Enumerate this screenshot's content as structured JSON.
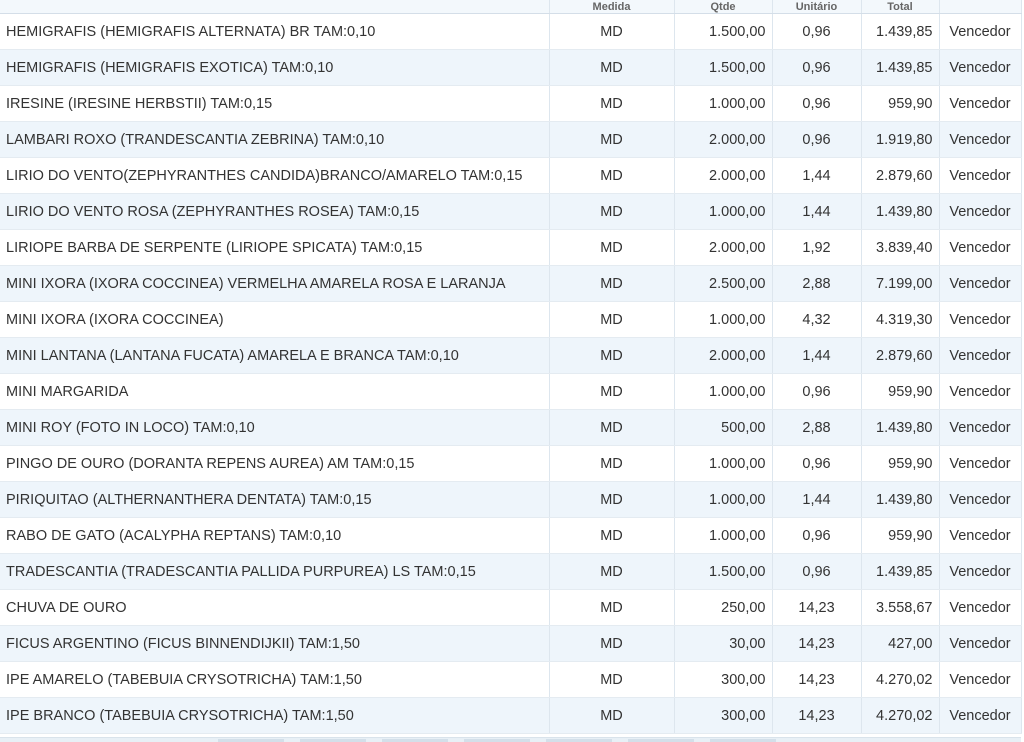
{
  "table": {
    "headers": [
      "Medida",
      "Qtde",
      "Unitário",
      "Total",
      ""
    ],
    "rows": [
      {
        "description": "HEMIGRAFIS (HEMIGRAFIS ALTERNATA) BR TAM:0,10",
        "unit": "MD",
        "quantity": "1.500,00",
        "unit_price": "0,96",
        "total": "1.439,85",
        "status": "Vencedor"
      },
      {
        "description": "HEMIGRAFIS (HEMIGRAFIS EXOTICA) TAM:0,10",
        "unit": "MD",
        "quantity": "1.500,00",
        "unit_price": "0,96",
        "total": "1.439,85",
        "status": "Vencedor"
      },
      {
        "description": "IRESINE (IRESINE HERBSTII) TAM:0,15",
        "unit": "MD",
        "quantity": "1.000,00",
        "unit_price": "0,96",
        "total": "959,90",
        "status": "Vencedor"
      },
      {
        "description": "LAMBARI ROXO (TRANDESCANTIA ZEBRINA) TAM:0,10",
        "unit": "MD",
        "quantity": "2.000,00",
        "unit_price": "0,96",
        "total": "1.919,80",
        "status": "Vencedor"
      },
      {
        "description": "LIRIO DO VENTO(ZEPHYRANTHES CANDIDA)BRANCO/AMARELO TAM:0,15",
        "unit": "MD",
        "quantity": "2.000,00",
        "unit_price": "1,44",
        "total": "2.879,60",
        "status": "Vencedor"
      },
      {
        "description": "LIRIO DO VENTO ROSA (ZEPHYRANTHES ROSEA) TAM:0,15",
        "unit": "MD",
        "quantity": "1.000,00",
        "unit_price": "1,44",
        "total": "1.439,80",
        "status": "Vencedor"
      },
      {
        "description": "LIRIOPE BARBA DE SERPENTE (LIRIOPE SPICATA) TAM:0,15",
        "unit": "MD",
        "quantity": "2.000,00",
        "unit_price": "1,92",
        "total": "3.839,40",
        "status": "Vencedor"
      },
      {
        "description": "MINI IXORA (IXORA COCCINEA) VERMELHA AMARELA ROSA E LARANJA",
        "unit": "MD",
        "quantity": "2.500,00",
        "unit_price": "2,88",
        "total": "7.199,00",
        "status": "Vencedor"
      },
      {
        "description": "MINI IXORA (IXORA COCCINEA)",
        "unit": "MD",
        "quantity": "1.000,00",
        "unit_price": "4,32",
        "total": "4.319,30",
        "status": "Vencedor"
      },
      {
        "description": "MINI LANTANA (LANTANA FUCATA) AMARELA E BRANCA TAM:0,10",
        "unit": "MD",
        "quantity": "2.000,00",
        "unit_price": "1,44",
        "total": "2.879,60",
        "status": "Vencedor"
      },
      {
        "description": "MINI MARGARIDA",
        "unit": "MD",
        "quantity": "1.000,00",
        "unit_price": "0,96",
        "total": "959,90",
        "status": "Vencedor"
      },
      {
        "description": "MINI ROY (FOTO IN LOCO) TAM:0,10",
        "unit": "MD",
        "quantity": "500,00",
        "unit_price": "2,88",
        "total": "1.439,80",
        "status": "Vencedor"
      },
      {
        "description": "PINGO DE OURO (DORANTA REPENS AUREA) AM TAM:0,15",
        "unit": "MD",
        "quantity": "1.000,00",
        "unit_price": "0,96",
        "total": "959,90",
        "status": "Vencedor"
      },
      {
        "description": "PIRIQUITAO (ALTHERNANTHERA DENTATA) TAM:0,15",
        "unit": "MD",
        "quantity": "1.000,00",
        "unit_price": "1,44",
        "total": "1.439,80",
        "status": "Vencedor"
      },
      {
        "description": "RABO DE GATO (ACALYPHA REPTANS) TAM:0,10",
        "unit": "MD",
        "quantity": "1.000,00",
        "unit_price": "0,96",
        "total": "959,90",
        "status": "Vencedor"
      },
      {
        "description": "TRADESCANTIA (TRADESCANTIA PALLIDA PURPUREA) LS TAM:0,15",
        "unit": "MD",
        "quantity": "1.500,00",
        "unit_price": "0,96",
        "total": "1.439,85",
        "status": "Vencedor"
      },
      {
        "description": "CHUVA DE OURO",
        "unit": "MD",
        "quantity": "250,00",
        "unit_price": "14,23",
        "total": "3.558,67",
        "status": "Vencedor"
      },
      {
        "description": "FICUS ARGENTINO (FICUS BINNENDIJKII) TAM:1,50",
        "unit": "MD",
        "quantity": "30,00",
        "unit_price": "14,23",
        "total": "427,00",
        "status": "Vencedor"
      },
      {
        "description": "IPE AMARELO (TABEBUIA CRYSOTRICHA) TAM:1,50",
        "unit": "MD",
        "quantity": "300,00",
        "unit_price": "14,23",
        "total": "4.270,02",
        "status": "Vencedor"
      },
      {
        "description": "IPE BRANCO (TABEBUIA CRYSOTRICHA) TAM:1,50",
        "unit": "MD",
        "quantity": "300,00",
        "unit_price": "14,23",
        "total": "4.270,02",
        "status": "Vencedor"
      }
    ]
  },
  "colors": {
    "row_alt": "#eef5fb",
    "row_base": "#ffffff",
    "text": "#333333",
    "grid_line": "#dde6ee"
  }
}
